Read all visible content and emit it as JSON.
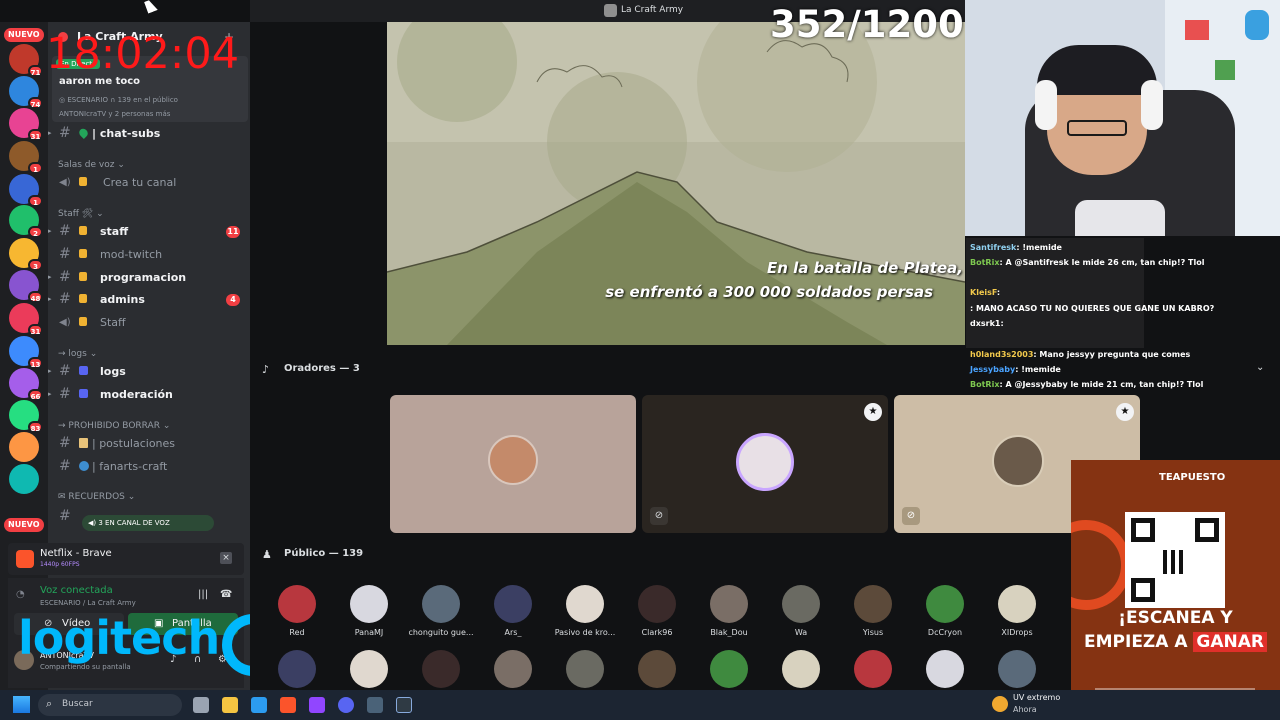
{
  "window": {
    "title": "La Craft Army"
  },
  "overlay": {
    "timer": "18:02:04",
    "viewer_count": "352/1200"
  },
  "rail": {
    "nuevo_top": "NUEVO",
    "nuevo_bottom": "NUEVO",
    "badges": [
      "71",
      "74",
      "31",
      "1",
      "1",
      "2",
      "3",
      "48",
      "31",
      "13",
      "66",
      "83"
    ]
  },
  "sidebar": {
    "server_name": "La Craft Army",
    "live": {
      "badge": "En Directo",
      "title": "aaron me toco",
      "stage_tag": "ESCENARIO",
      "audience": "139 en el público",
      "speakers": "ANTONIcraTV y 2 personas más"
    },
    "chat_subs": "| chat-subs",
    "voice_category": "Salas de voz",
    "voice_channel": "Crea tu canal",
    "staff_category": "Staff 🛠",
    "channels": [
      {
        "name": "staff",
        "count": "11"
      },
      {
        "name": "mod-twitch",
        "count": ""
      },
      {
        "name": "programacion",
        "count": ""
      },
      {
        "name": "admins",
        "count": "4"
      },
      {
        "name": "Staff",
        "count": ""
      }
    ],
    "logs_category": "logs",
    "logs": "logs",
    "moderacion": "moderación",
    "prohibido_category": "PROHIBIDO BORRAR",
    "postulaciones": "| postulaciones",
    "fanarts": "| fanarts-craft",
    "recuerdos_category": "RECUERDOS",
    "voice_pill": "3 EN CANAL DE VOZ"
  },
  "activity": {
    "title": "Netflix - Brave",
    "quality": "1440p 60FPS"
  },
  "voice_panel": {
    "status": "Voz conectada",
    "location": "ESCENARIO / La Craft Army",
    "video_label": "Vídeo",
    "screen_label": "Pantalla",
    "user_name": "ANTONIcraTV",
    "user_status": "Compartiendo su pantalla"
  },
  "stage": {
    "subtitle_line1": "En la batalla de Platea,",
    "subtitle_line2": "se enfrentó a 300 000 soldados persas",
    "speakers_header": "Oradores — 3",
    "audience_header": "Público — 139",
    "audience": [
      "Red",
      "PanaMJ",
      "chonguito gue...",
      "Ars_",
      "Pasivo de kro...",
      "Clark96",
      "Blak_Dou",
      "Wa",
      "Yisus",
      "DcCryon",
      "XIDrops"
    ]
  },
  "chat": [
    {
      "user": "Santifresk",
      "msg": ": !memide",
      "color": "#8fd0f0"
    },
    {
      "user": "BotRix",
      "msg": ": A @Santifresk le mide 26 cm, tan chip!? Tlol",
      "color": "#7ec850"
    },
    {
      "user": "KleisF",
      "msg": ":",
      "color": "#f2c94c"
    },
    {
      "user": "",
      "msg": ": MANO ACASO TU NO QUIERES QUE GANE UN KABRO?",
      "color": "#ff6060"
    },
    {
      "user": "dxsrk1",
      "msg": ":",
      "color": "#ffffff"
    },
    {
      "user": "h0land3s2003",
      "msg": ": Mano jessyy pregunta que comes",
      "color": "#f2c94c"
    },
    {
      "user": "Jessybaby",
      "msg": ": !memide",
      "color": "#4aa3ff"
    },
    {
      "user": "BotRix",
      "msg": ": A @Jessybaby le mide 21 cm, tan chip!? Tlol",
      "color": "#7ec850"
    }
  ],
  "ad": {
    "brand": "TEAPUESTO",
    "line1": "¡ESCANEA Y",
    "line2a": "EMPIEZA A ",
    "line2b": "GANAR"
  },
  "logo": {
    "text": "logitech"
  },
  "taskbar": {
    "search_placeholder": "Buscar",
    "weather_label": "UV extremo",
    "weather_sub": "Ahora"
  }
}
